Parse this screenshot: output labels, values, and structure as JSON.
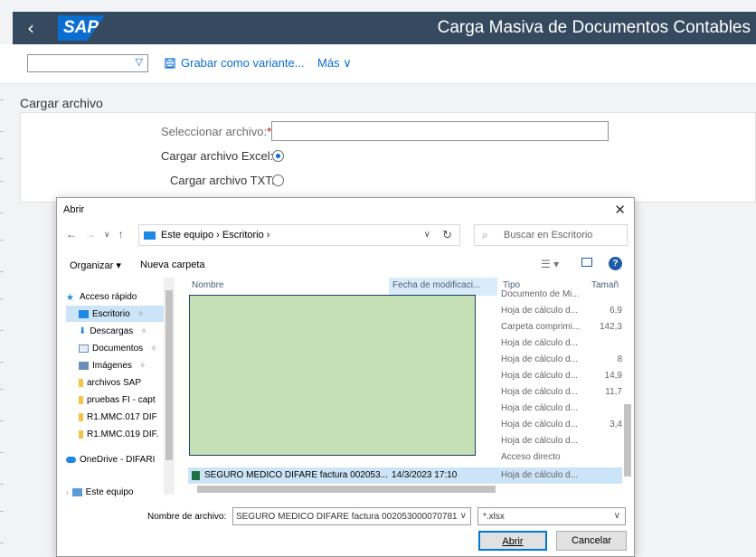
{
  "header": {
    "title": "Carga Masiva de Documentos Contables",
    "logo": "SAP"
  },
  "toolbar": {
    "save_variant": "Grabar como variante...",
    "more": "Más"
  },
  "section": {
    "title": "Cargar archivo"
  },
  "form": {
    "select_file_label": "Seleccionar archivo:",
    "required_mark": "*",
    "excel_label": "Cargar archivo Excel:",
    "txt_label": "Cargar archivo TXT:",
    "excel_selected": true
  },
  "dialog": {
    "title": "Abrir",
    "path": "Este equipo  ›  Escritorio  ›",
    "search_placeholder": "Buscar en Escritorio",
    "organize": "Organizar ▾",
    "new_folder": "Nueva carpeta",
    "nav_items": [
      {
        "label": "Acceso rápido",
        "icon": "star-icon",
        "pinned": false
      },
      {
        "label": "Escritorio",
        "icon": "desktop-folder-icon",
        "pinned": true
      },
      {
        "label": "Descargas",
        "icon": "download-folder-icon",
        "pinned": true
      },
      {
        "label": "Documentos",
        "icon": "documents-folder-icon",
        "pinned": true
      },
      {
        "label": "Imágenes",
        "icon": "pictures-folder-icon",
        "pinned": true
      },
      {
        "label": "archivos SAP",
        "icon": "folder-icon",
        "pinned": false
      },
      {
        "label": "pruebas FI - capt",
        "icon": "folder-icon",
        "pinned": false
      },
      {
        "label": "R1.MMC.017 DIF",
        "icon": "folder-icon",
        "pinned": false
      },
      {
        "label": "R1.MMC.019 DIF.",
        "icon": "folder-icon",
        "pinned": false
      },
      {
        "label": "OneDrive - DIFARI",
        "icon": "cloud-icon",
        "pinned": false
      },
      {
        "label": "Este equipo",
        "icon": "computer-icon",
        "pinned": false
      }
    ],
    "columns": {
      "name": "Nombre",
      "date": "Fecha de modificaci...",
      "type": "Tipo",
      "size": "Tamañ"
    },
    "rows": [
      {
        "type": "Documento de Mi...",
        "size": ""
      },
      {
        "type": "Hoja de cálculo d...",
        "size": "6,9"
      },
      {
        "type": "Carpeta comprimi...",
        "size": "142,3"
      },
      {
        "type": "Hoja de cálculo d...",
        "size": ""
      },
      {
        "type": "Hoja de cálculo d...",
        "size": "8"
      },
      {
        "type": "Hoja de cálculo d...",
        "size": "14,9"
      },
      {
        "type": "Hoja de cálculo d...",
        "size": "11,7"
      },
      {
        "type": "Hoja de cálculo d...",
        "size": ""
      },
      {
        "type": "Hoja de cálculo d...",
        "size": "3,4"
      },
      {
        "type": "Hoja de cálculo d...",
        "size": ""
      },
      {
        "type": "Acceso directo",
        "size": ""
      }
    ],
    "selected_row": {
      "name": "SEGURO MEDICO DIFARE factura 002053...",
      "date": "14/3/2023 17:10",
      "type": "Hoja de cálculo d..."
    },
    "filename_label": "Nombre de archivo:",
    "filename_value": "SEGURO MEDICO DIFARE factura 002053000070781",
    "filetype_value": "*.xlsx",
    "open_button": "Abrir",
    "cancel_button": "Cancelar"
  }
}
